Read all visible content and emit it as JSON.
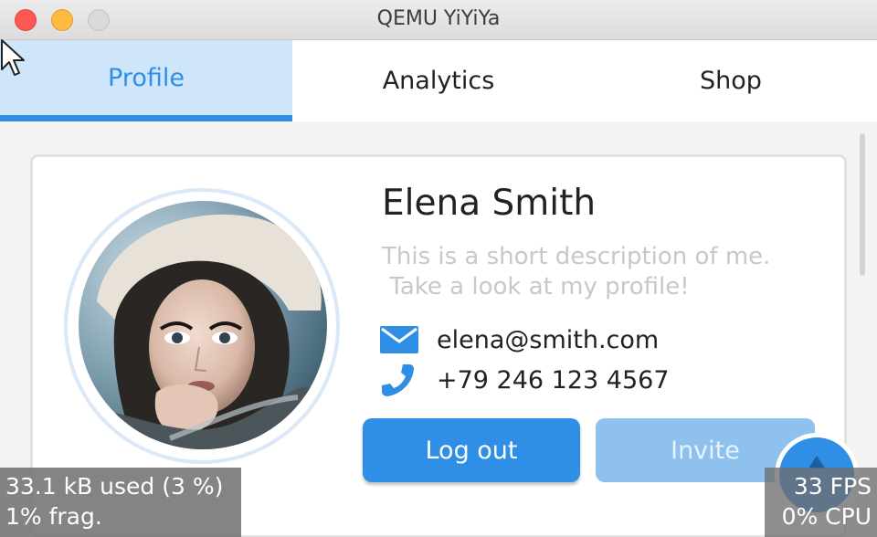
{
  "window": {
    "title": "QEMU YiYiYa"
  },
  "tabs": [
    {
      "label": "Profile",
      "active": true
    },
    {
      "label": "Analytics",
      "active": false
    },
    {
      "label": "Shop",
      "active": false
    }
  ],
  "profile": {
    "name": "Elena Smith",
    "description": "This is a short description of me.\n Take a look at my profile!",
    "email": "elena@smith.com",
    "phone": "+79 246 123 4567",
    "email_icon": "envelope-icon",
    "phone_icon": "phone-icon"
  },
  "buttons": {
    "logout": "Log out",
    "invite": "Invite"
  },
  "stats": {
    "memory": "33.1 kB used (3 %)\n1% frag.",
    "performance": "33 FPS\n0% CPU"
  },
  "colors": {
    "accent": "#2f8ee6",
    "accent_light": "#8ec1ee",
    "tab_active_bg": "#cfe5f9"
  }
}
